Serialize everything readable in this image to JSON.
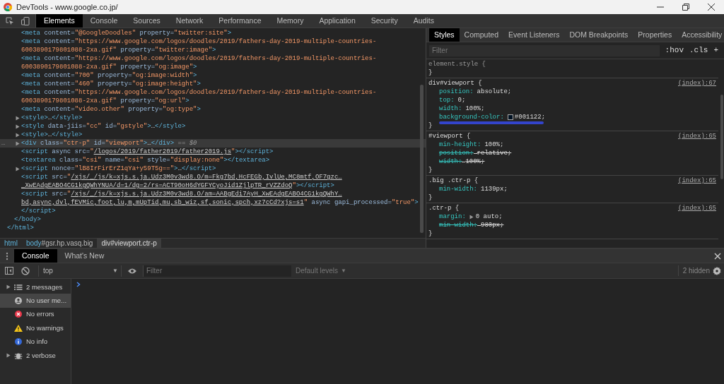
{
  "window": {
    "title": "DevTools - www.google.co.jp/"
  },
  "main_tabs": [
    {
      "label": "Elements",
      "selected": true
    },
    {
      "label": "Console",
      "selected": false
    },
    {
      "label": "Sources",
      "selected": false
    },
    {
      "label": "Network",
      "selected": false
    },
    {
      "label": "Performance",
      "selected": false
    },
    {
      "label": "Memory",
      "selected": false
    },
    {
      "label": "Application",
      "selected": false
    },
    {
      "label": "Security",
      "selected": false
    },
    {
      "label": "Audits",
      "selected": false
    }
  ],
  "dom_tree": [
    {
      "children": [
        {
          "children": [
            {
              "lines": [
                [
                  {
                    "kind": "tag",
                    "text": "<meta"
                  },
                  {
                    "kind": "attr",
                    "text": " content="
                  },
                  {
                    "kind": "value",
                    "text": "\"@GoogleDoodles\""
                  },
                  {
                    "kind": "attr",
                    "text": " property="
                  },
                  {
                    "kind": "value",
                    "text": "\"twitter:site\""
                  },
                  {
                    "kind": "tag",
                    "text": ">"
                  }
                ]
              ]
            },
            {
              "lines": [
                [
                  {
                    "kind": "tag",
                    "text": "<meta"
                  },
                  {
                    "kind": "attr",
                    "text": " content="
                  },
                  {
                    "kind": "value",
                    "text": "\"https://www.google.com/logos/doodles/2019/fathers-day-2019-multiple-countries-"
                  }
                ],
                [
                  {
                    "kind": "value",
                    "text": "6003890179801088-2xa.gif\""
                  },
                  {
                    "kind": "attr",
                    "text": " property="
                  },
                  {
                    "kind": "value",
                    "text": "\"twitter:image\""
                  },
                  {
                    "kind": "tag",
                    "text": ">"
                  }
                ]
              ]
            },
            {
              "lines": [
                [
                  {
                    "kind": "tag",
                    "text": "<meta"
                  },
                  {
                    "kind": "attr",
                    "text": " content="
                  },
                  {
                    "kind": "value",
                    "text": "\"https://www.google.com/logos/doodles/2019/fathers-day-2019-multiple-countries-"
                  }
                ],
                [
                  {
                    "kind": "value",
                    "text": "6003890179801088-2xa.gif\""
                  },
                  {
                    "kind": "attr",
                    "text": " property="
                  },
                  {
                    "kind": "value",
                    "text": "\"og:image\""
                  },
                  {
                    "kind": "tag",
                    "text": ">"
                  }
                ]
              ]
            },
            {
              "lines": [
                [
                  {
                    "kind": "tag",
                    "text": "<meta"
                  },
                  {
                    "kind": "attr",
                    "text": " content="
                  },
                  {
                    "kind": "value",
                    "text": "\"700\""
                  },
                  {
                    "kind": "attr",
                    "text": " property="
                  },
                  {
                    "kind": "value",
                    "text": "\"og:image:width\""
                  },
                  {
                    "kind": "tag",
                    "text": ">"
                  }
                ]
              ]
            },
            {
              "lines": [
                [
                  {
                    "kind": "tag",
                    "text": "<meta"
                  },
                  {
                    "kind": "attr",
                    "text": " content="
                  },
                  {
                    "kind": "value",
                    "text": "\"460\""
                  },
                  {
                    "kind": "attr",
                    "text": " property="
                  },
                  {
                    "kind": "value",
                    "text": "\"og:image:height\""
                  },
                  {
                    "kind": "tag",
                    "text": ">"
                  }
                ]
              ]
            },
            {
              "lines": [
                [
                  {
                    "kind": "tag",
                    "text": "<meta"
                  },
                  {
                    "kind": "attr",
                    "text": " content="
                  },
                  {
                    "kind": "value",
                    "text": "\"https://www.google.com/logos/doodles/2019/fathers-day-2019-multiple-countries-"
                  }
                ],
                [
                  {
                    "kind": "value",
                    "text": "6003890179801088-2xa.gif\""
                  },
                  {
                    "kind": "attr",
                    "text": " property="
                  },
                  {
                    "kind": "value",
                    "text": "\"og:url\""
                  },
                  {
                    "kind": "tag",
                    "text": ">"
                  }
                ]
              ]
            },
            {
              "lines": [
                [
                  {
                    "kind": "tag",
                    "text": "<meta"
                  },
                  {
                    "kind": "attr",
                    "text": " content="
                  },
                  {
                    "kind": "value",
                    "text": "\"video.other\""
                  },
                  {
                    "kind": "attr",
                    "text": " property="
                  },
                  {
                    "kind": "value",
                    "text": "\"og:type\""
                  },
                  {
                    "kind": "tag",
                    "text": ">"
                  }
                ]
              ]
            },
            {
              "collapsed": true,
              "lines": [
                [
                  {
                    "kind": "tag",
                    "text": "<style>"
                  },
                  {
                    "kind": "text",
                    "text": "…"
                  },
                  {
                    "kind": "tag",
                    "text": "</style>"
                  }
                ]
              ]
            },
            {
              "collapsed": true,
              "lines": [
                [
                  {
                    "kind": "tag",
                    "text": "<style"
                  },
                  {
                    "kind": "attr",
                    "text": " data-jiis="
                  },
                  {
                    "kind": "value",
                    "text": "\"cc\""
                  },
                  {
                    "kind": "attr",
                    "text": " id="
                  },
                  {
                    "kind": "value",
                    "text": "\"gstyle\""
                  },
                  {
                    "kind": "tag",
                    "text": ">"
                  },
                  {
                    "kind": "text",
                    "text": "…"
                  },
                  {
                    "kind": "tag",
                    "text": "</style>"
                  }
                ]
              ]
            },
            {
              "collapsed": true,
              "lines": [
                [
                  {
                    "kind": "tag",
                    "text": "<style>"
                  },
                  {
                    "kind": "text",
                    "text": "…"
                  },
                  {
                    "kind": "tag",
                    "text": "</style>"
                  }
                ]
              ]
            },
            {
              "collapsed": true,
              "selected": true,
              "gutter_text": "…",
              "lines": [
                [
                  {
                    "kind": "tag",
                    "text": "<div"
                  },
                  {
                    "kind": "attr",
                    "text": " class="
                  },
                  {
                    "kind": "value",
                    "text": "\"ctr-p\""
                  },
                  {
                    "kind": "attr",
                    "text": " id="
                  },
                  {
                    "kind": "value",
                    "text": "\"viewport\""
                  },
                  {
                    "kind": "tag",
                    "text": ">"
                  },
                  {
                    "kind": "text",
                    "text": "…"
                  },
                  {
                    "kind": "tag",
                    "text": "</div>"
                  },
                  {
                    "kind": "marker",
                    "text": " == $0"
                  }
                ]
              ]
            },
            {
              "lines": [
                [
                  {
                    "kind": "tag",
                    "text": "<script"
                  },
                  {
                    "kind": "attr",
                    "text": " async src="
                  },
                  {
                    "kind": "value",
                    "text": "\""
                  },
                  {
                    "kind": "link",
                    "text": "/logos/2019/father2019/father2019.js"
                  },
                  {
                    "kind": "value",
                    "text": "\""
                  },
                  {
                    "kind": "tag",
                    "text": "></script>"
                  }
                ]
              ]
            },
            {
              "lines": [
                [
                  {
                    "kind": "tag",
                    "text": "<textarea"
                  },
                  {
                    "kind": "attr",
                    "text": " class="
                  },
                  {
                    "kind": "value",
                    "text": "\"csi\""
                  },
                  {
                    "kind": "attr",
                    "text": " name="
                  },
                  {
                    "kind": "value",
                    "text": "\"csi\""
                  },
                  {
                    "kind": "attr",
                    "text": " style="
                  },
                  {
                    "kind": "value",
                    "text": "\"display:none\""
                  },
                  {
                    "kind": "tag",
                    "text": "></textarea>"
                  }
                ]
              ]
            },
            {
              "collapsed": true,
              "lines": [
                [
                  {
                    "kind": "tag",
                    "text": "<script"
                  },
                  {
                    "kind": "attr",
                    "text": " nonce="
                  },
                  {
                    "kind": "value",
                    "text": "\"lB8IrFirErZ1qYa+y59T5g==\""
                  },
                  {
                    "kind": "tag",
                    "text": ">"
                  },
                  {
                    "kind": "text",
                    "text": "…"
                  },
                  {
                    "kind": "tag",
                    "text": "</script>"
                  }
                ]
              ]
            },
            {
              "lines": [
                [
                  {
                    "kind": "tag",
                    "text": "<script"
                  },
                  {
                    "kind": "attr",
                    "text": " src="
                  },
                  {
                    "kind": "value",
                    "text": "\""
                  },
                  {
                    "kind": "link",
                    "text": "/xjs/_/js/k=xjs.s.ja.Udz3M0v3wd8.O/m=Fkg7bd,HcFEGb,IvlUe,MC8mtf,OF7gzc…"
                  }
                ],
                [
                  {
                    "kind": "link",
                    "text": "_XwEAdgEABO4CG1kgQWhYNUA/d=1/dg=2/rs=ACT90oH6dYGFYCyoJid1ZjlpTR_rVZZdoQ"
                  },
                  {
                    "kind": "value",
                    "text": "\""
                  },
                  {
                    "kind": "tag",
                    "text": "></script>"
                  }
                ]
              ]
            },
            {
              "lines": [
                [
                  {
                    "kind": "tag",
                    "text": "<script"
                  },
                  {
                    "kind": "attr",
                    "text": " src="
                  },
                  {
                    "kind": "value",
                    "text": "\""
                  },
                  {
                    "kind": "link",
                    "text": "/xjs/_/js/k=xjs.s.ja.Udz3M0v3wd8.O/am=AABgEdi7AyH_XwEAdgEABO4CG1kgQWhY…"
                  }
                ],
                [
                  {
                    "kind": "link",
                    "text": "bd,async,dvl,fEVMic,foot,lu,m,mUpTid,mu,sb_wiz,sf,sonic,spch,xz7cCd?xjs=s1"
                  },
                  {
                    "kind": "value",
                    "text": "\""
                  },
                  {
                    "kind": "attr",
                    "text": " async gapi_processed="
                  },
                  {
                    "kind": "value",
                    "text": "\"true\""
                  },
                  {
                    "kind": "tag",
                    "text": ">"
                  }
                ],
                [
                  {
                    "kind": "tag",
                    "text": "</script>"
                  }
                ]
              ]
            }
          ]
        },
        {
          "lines": [
            [
              {
                "kind": "tag",
                "text": "</body>"
              }
            ]
          ]
        }
      ]
    },
    {
      "lines": [
        [
          {
            "kind": "tag",
            "text": "</html>"
          }
        ]
      ]
    }
  ],
  "breadcrumbs": [
    {
      "tag": "html",
      "selected": false
    },
    {
      "tag": "body",
      "rest": "#gsr.hp.vasq.big",
      "selected": false
    },
    {
      "tag": "div",
      "rest": "#viewport.ctr-p",
      "selected": true
    }
  ],
  "styles_tabs": [
    {
      "label": "Styles",
      "selected": true
    },
    {
      "label": "Computed",
      "selected": false
    },
    {
      "label": "Event Listeners",
      "selected": false
    },
    {
      "label": "DOM Breakpoints",
      "selected": false
    },
    {
      "label": "Properties",
      "selected": false
    },
    {
      "label": "Accessibility",
      "selected": false
    }
  ],
  "styles_filter": {
    "placeholder": "Filter",
    "buttons": [
      ":hov",
      ".cls",
      "+"
    ]
  },
  "rules": [
    {
      "selector": "element.style {",
      "inline": true,
      "close": "}"
    },
    {
      "selector": "div#viewport {",
      "inline": false,
      "source": "(index):67",
      "close": "}",
      "properties": [
        {
          "name": "position:",
          "value": "absolute;",
          "struck": false
        },
        {
          "name": "top:",
          "value": "0;",
          "struck": false
        },
        {
          "name": "width:",
          "value": "100%;",
          "struck": false
        },
        {
          "name": "background-color:",
          "value": "#001122;",
          "swatch": true,
          "struck": false,
          "highlighted": true
        }
      ]
    },
    {
      "selector": "#viewport {",
      "inline": false,
      "source": "(index):65",
      "close": "}",
      "properties": [
        {
          "name": "min-height:",
          "value": "100%;",
          "struck": false
        },
        {
          "name": "position:",
          "value": "relative;",
          "struck": true
        },
        {
          "name": "width:",
          "value": "100%;",
          "struck": true
        }
      ]
    },
    {
      "selector": ".big .ctr-p {",
      "inline": false,
      "source": "(index):65",
      "close": "}",
      "properties": [
        {
          "name": "min-width:",
          "value": "1139px;",
          "struck": false
        }
      ]
    },
    {
      "selector": ".ctr-p {",
      "inline": false,
      "source": "(index):65",
      "close": "}",
      "properties": [
        {
          "name": "margin:",
          "value": "0 auto;",
          "expandable": true,
          "struck": false
        },
        {
          "name": "min-width:",
          "value": "980px;",
          "struck": true
        }
      ]
    }
  ],
  "drawer_tabs": [
    {
      "label": "Console",
      "selected": true
    },
    {
      "label": "What's New",
      "selected": false
    }
  ],
  "console_toolbar": {
    "context": "top",
    "context_caret": "▼",
    "filter_placeholder": "Filter",
    "levels": "Default levels",
    "levels_caret": "▼",
    "hidden": "2 hidden"
  },
  "console_sidebar": [
    {
      "kind": "list",
      "label": "2 messages",
      "expandable": true,
      "selected": false
    },
    {
      "kind": "user",
      "label": "No user me...",
      "expandable": false,
      "selected": true
    },
    {
      "kind": "error",
      "label": "No errors",
      "expandable": false,
      "selected": false
    },
    {
      "kind": "warning",
      "label": "No warnings",
      "expandable": false,
      "selected": false
    },
    {
      "kind": "info",
      "label": "No info",
      "expandable": false,
      "selected": false
    },
    {
      "kind": "verbose",
      "label": "2 verbose",
      "expandable": true,
      "selected": false
    }
  ]
}
